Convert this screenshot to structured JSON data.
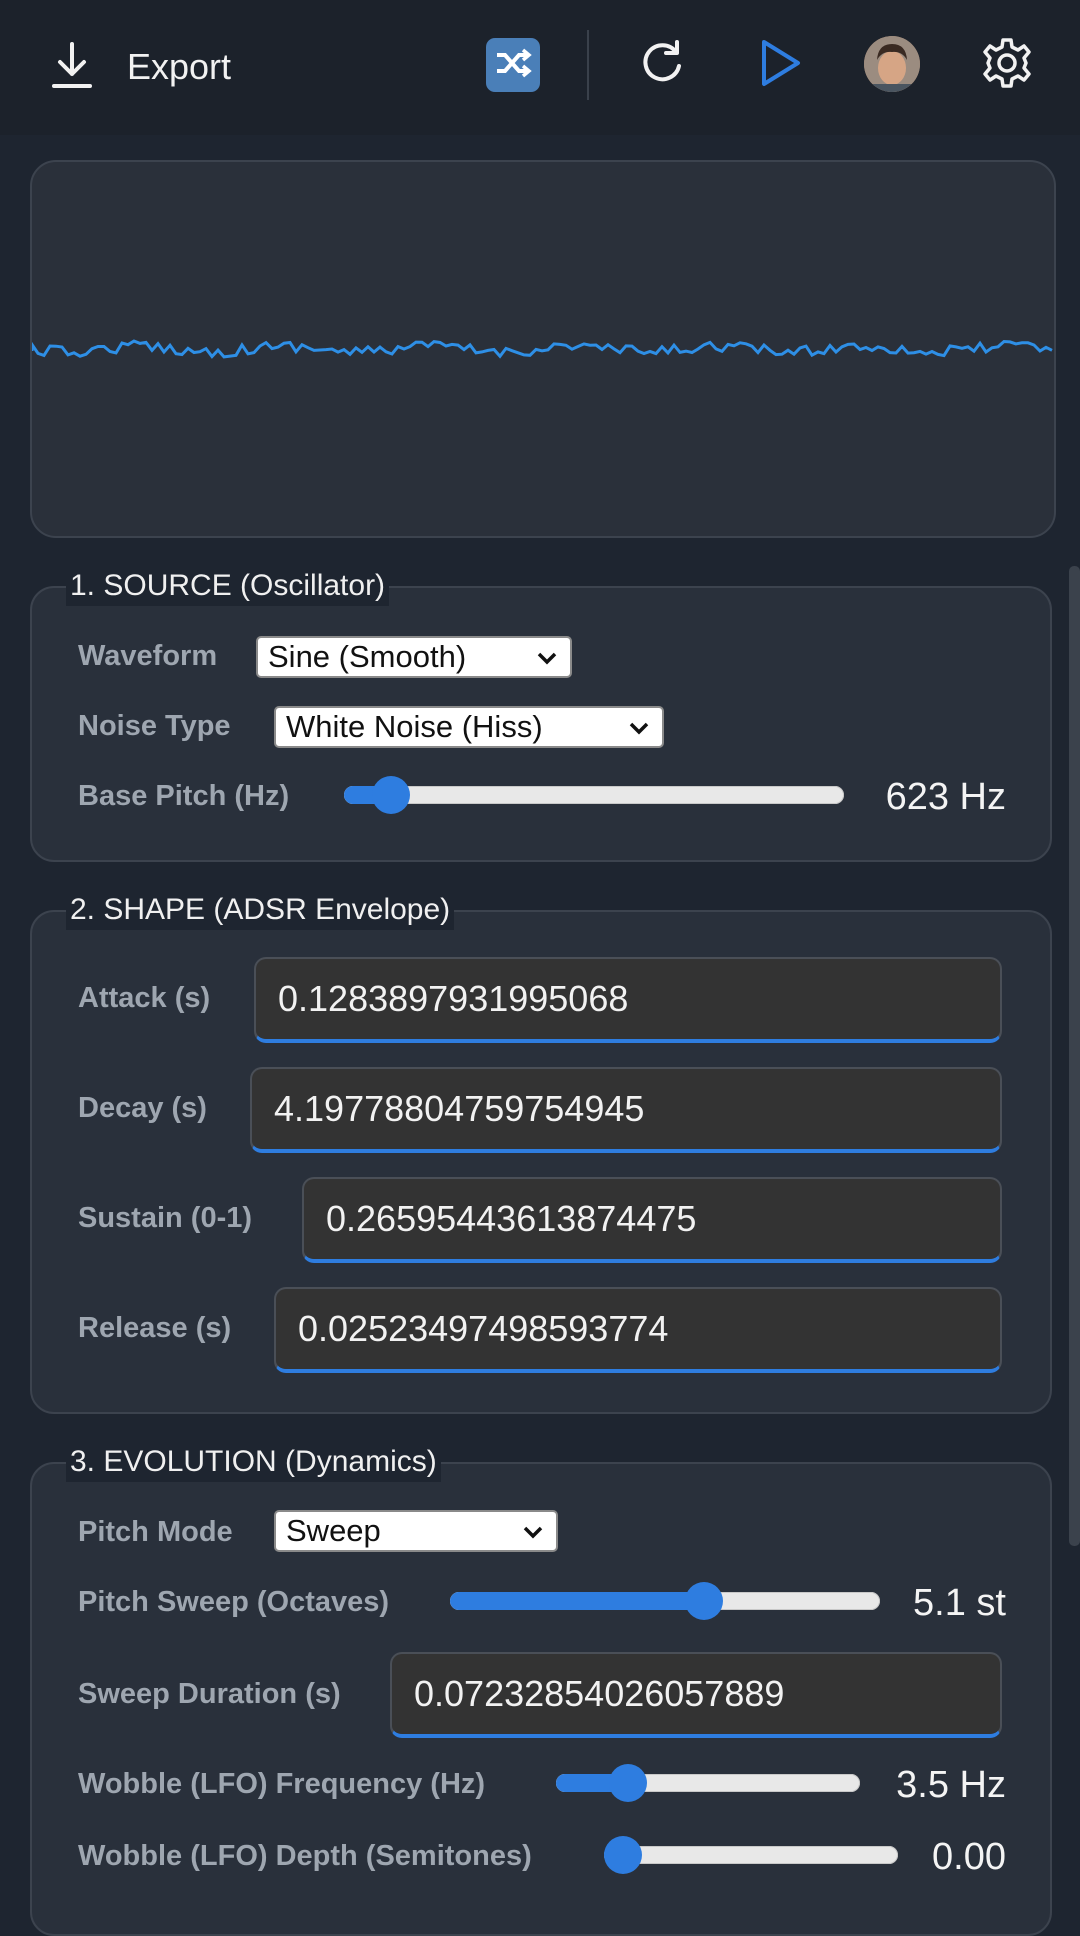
{
  "toolbar": {
    "export_label": "Export",
    "icons": [
      "download-icon",
      "shuffle-icon",
      "refresh-icon",
      "play-icon",
      "avatar",
      "gear-icon"
    ]
  },
  "colors": {
    "accent": "#2e7de0",
    "background": "#1e2530",
    "panel": "#29303b",
    "waveform": "#2e8fe6"
  },
  "source": {
    "title": "1. SOURCE (Oscillator)",
    "waveform_label": "Waveform",
    "waveform_value": "Sine (Smooth)",
    "noise_label": "Noise Type",
    "noise_value": "White Noise (Hiss)",
    "pitch_label": "Base Pitch (Hz)",
    "pitch_value": "623 Hz",
    "pitch_fraction": 0.06
  },
  "shape": {
    "title": "2. SHAPE (ADSR Envelope)",
    "attack_label": "Attack (s)",
    "attack_value": "0.1283897931995068",
    "decay_label": "Decay (s)",
    "decay_value": "4.19778804759754945",
    "sustain_label": "Sustain (0-1)",
    "sustain_value": "0.26595443613874475",
    "release_label": "Release (s)",
    "release_value": "0.02523497498593774"
  },
  "evolution": {
    "title": "3. EVOLUTION (Dynamics)",
    "pitch_mode_label": "Pitch Mode",
    "pitch_mode_value": "Sweep",
    "sweep_label": "Pitch Sweep (Octaves)",
    "sweep_value": "5.1 st",
    "sweep_fraction": 0.6,
    "sweep_duration_label": "Sweep Duration (s)",
    "sweep_duration_value": "0.07232854026057889",
    "lfo_freq_label": "Wobble (LFO) Frequency (Hz)",
    "lfo_freq_value": "3.5 Hz",
    "lfo_freq_fraction": 0.2,
    "lfo_depth_label": "Wobble (LFO) Depth (Semitones)",
    "lfo_depth_value": "0.00",
    "lfo_depth_fraction": 0.0
  }
}
